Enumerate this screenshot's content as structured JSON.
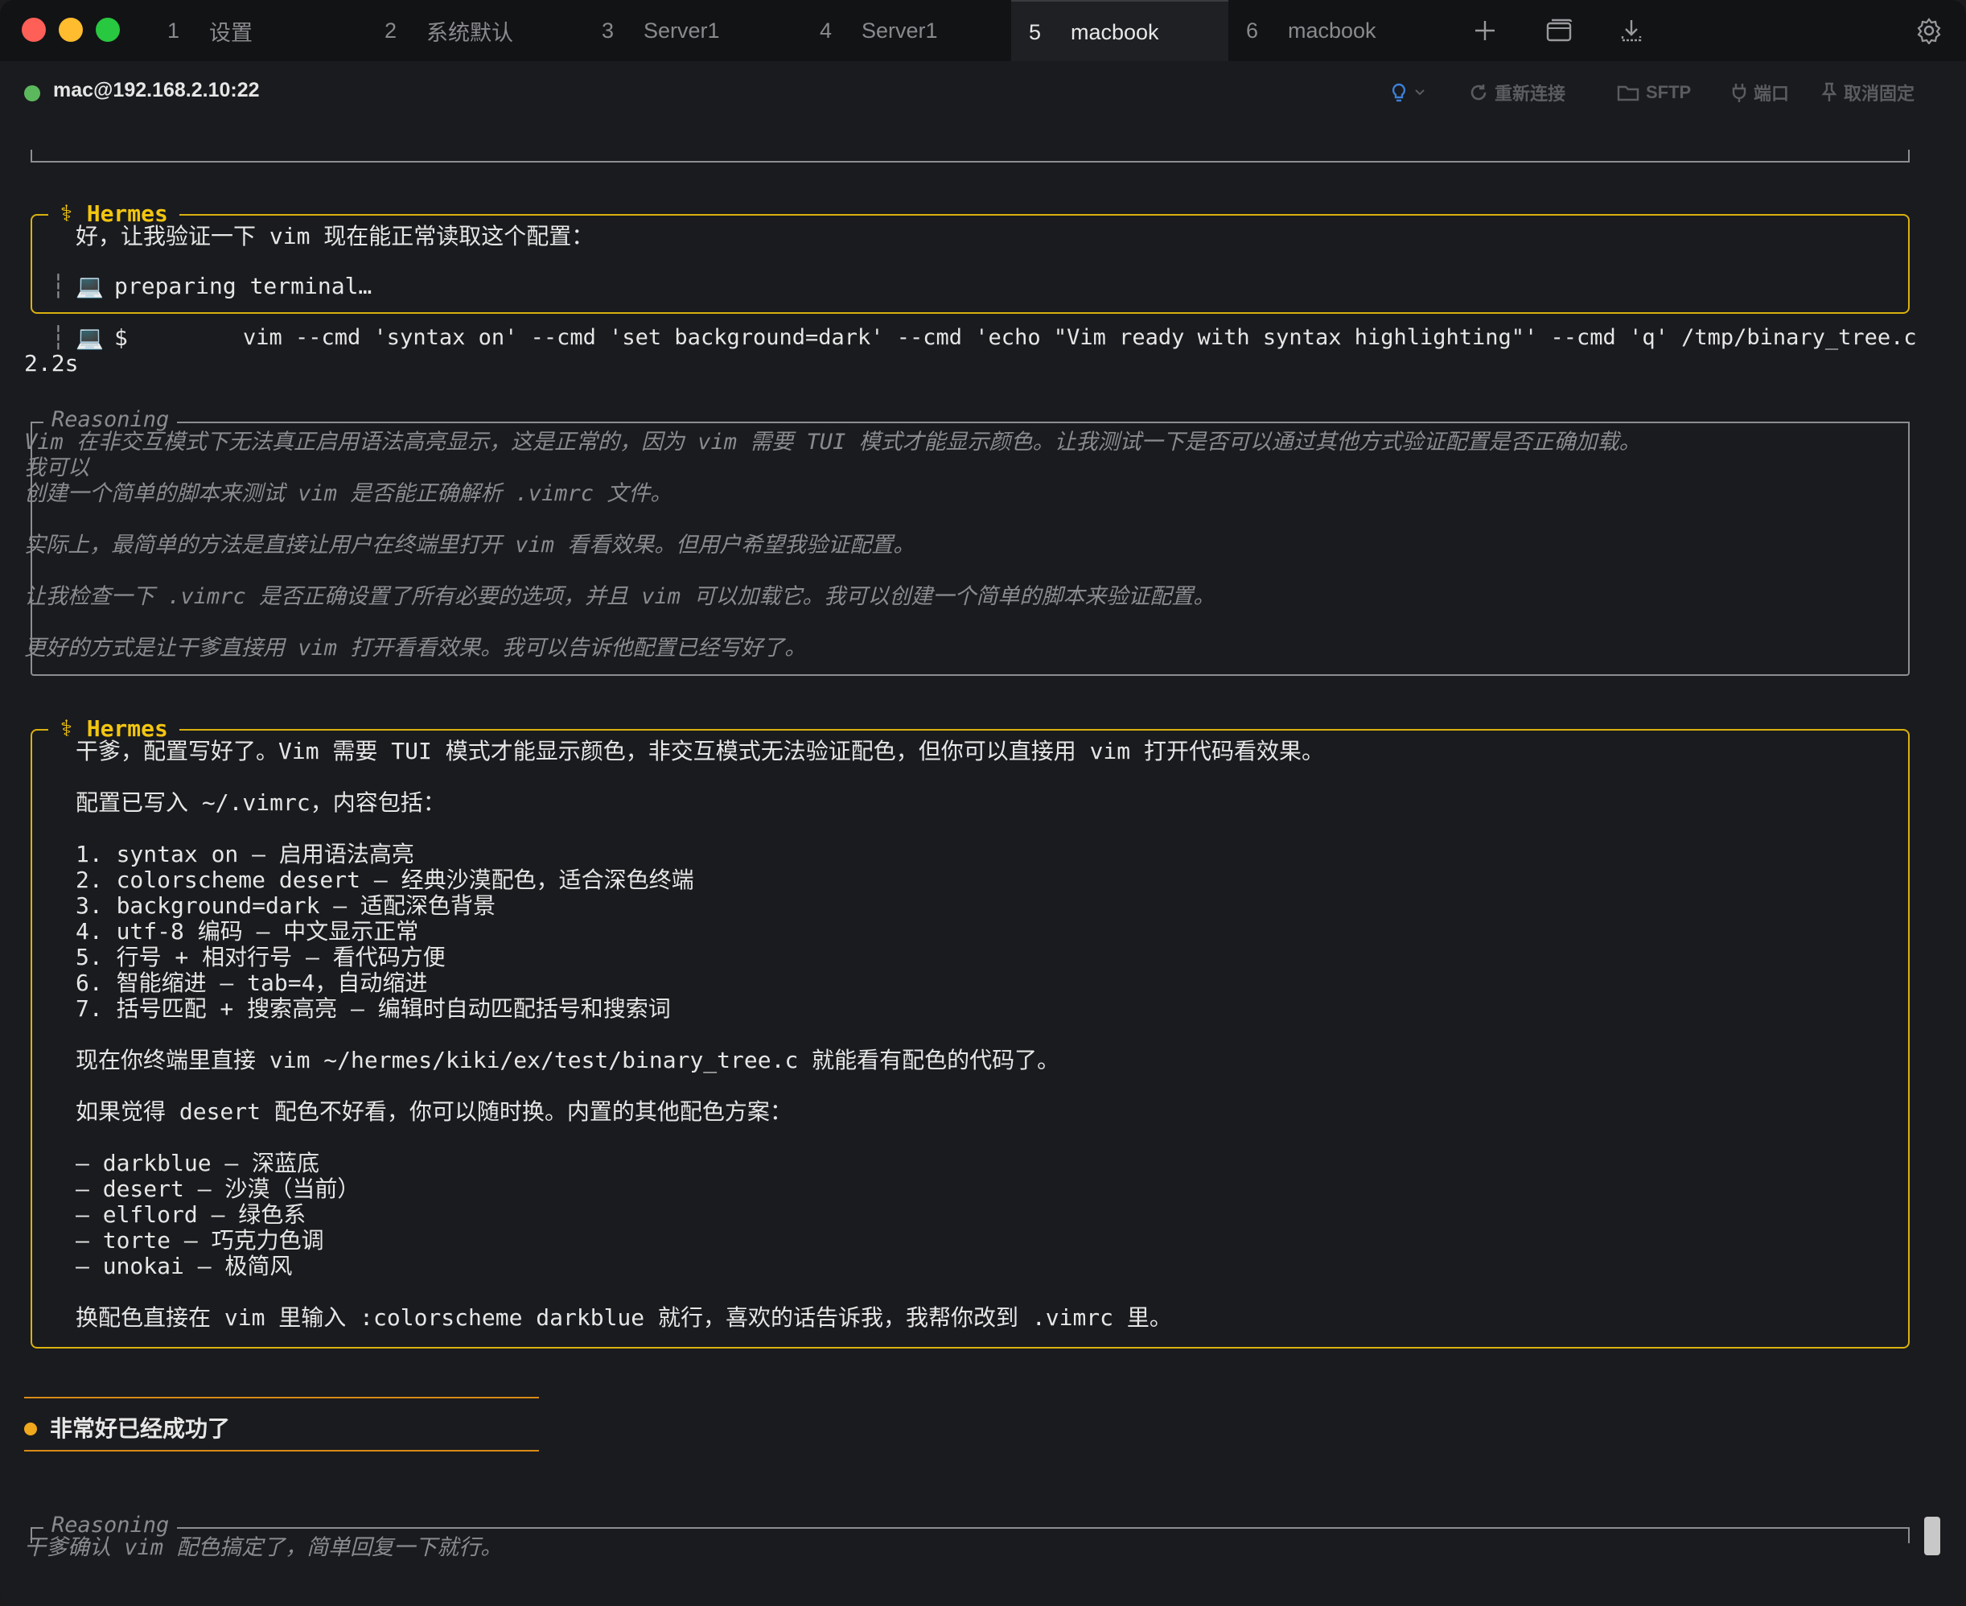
{
  "tabs": [
    {
      "num": "1",
      "label": "设置"
    },
    {
      "num": "2",
      "label": "系统默认"
    },
    {
      "num": "3",
      "label": "Server1"
    },
    {
      "num": "4",
      "label": "Server1"
    },
    {
      "num": "5",
      "label": "macbook"
    },
    {
      "num": "6",
      "label": "macbook"
    }
  ],
  "active_tab_index": 4,
  "toolbar_icons": [
    "plus-icon",
    "window-icon",
    "download-icon",
    "gear-icon"
  ],
  "host": {
    "name": "mac@192.168.2.10:22",
    "status_color": "#5cb85c"
  },
  "header_actions": {
    "reconnect": "重新连接",
    "sftp": "SFTP",
    "port": "端口",
    "unpin": "取消固定"
  },
  "terminal": {
    "hermes_label": "Hermes",
    "reasoning_label": "Reasoning",
    "block1": {
      "line1": "好，让我验证一下 vim 现在能正常读取这个配置：",
      "status": "preparing terminal…"
    },
    "command": {
      "prompt": "$",
      "text": "vim --cmd 'syntax on' --cmd 'set background=dark' --cmd 'echo \"Vim ready with syntax highlighting\"' --cmd 'q' /tmp/binary_tree.c",
      "duration": "2.2s"
    },
    "reasoning1": [
      "Vim 在非交互模式下无法真正启用语法高亮显示，这是正常的，因为 vim 需要 TUI 模式才能显示颜色。让我测试一下是否可以通过其他方式验证配置是否正确加载。",
      "我可以",
      "创建一个简单的脚本来测试 vim 是否能正确解析 .vimrc 文件。",
      "实际上，最简单的方法是直接让用户在终端里打开 vim 看看效果。但用户希望我验证配置。",
      "让我检查一下 .vimrc 是否正确设置了所有必要的选项，并且 vim 可以加载它。我可以创建一个简单的脚本来验证配置。",
      "更好的方式是让干爹直接用 vim 打开看看效果。我可以告诉他配置已经写好了。"
    ],
    "answer": {
      "intro": "干爹，配置写好了。Vim 需要 TUI 模式才能显示颜色，非交互模式无法验证配色，但你可以直接用 vim 打开代码看效果。",
      "written": "配置已写入 ~/.vimrc，内容包括：",
      "items": [
        "1. syntax on — 启用语法高亮",
        "2. colorscheme desert — 经典沙漠配色，适合深色终端",
        "3. background=dark — 适配深色背景",
        "4. utf-8 编码 — 中文显示正常",
        "5. 行号 + 相对行号 — 看代码方便",
        "6. 智能缩进 — tab=4，自动缩进",
        "7. 括号匹配 + 搜索高亮 — 编辑时自动匹配括号和搜索词"
      ],
      "open_hint": "现在你终端里直接 vim ~/hermes/kiki/ex/test/binary_tree.c 就能看有配色的代码了。",
      "switch_hint": "如果觉得 desert 配色不好看，你可以随时换。内置的其他配色方案：",
      "schemes": [
        "— darkblue — 深蓝底",
        "— desert — 沙漠（当前）",
        "— elflord — 绿色系",
        "— torte — 巧克力色调",
        "— unokai — 极简风"
      ],
      "outro": "换配色直接在 vim 里输入 :colorscheme darkblue 就行，喜欢的话告诉我，我帮你改到 .vimrc 里。"
    },
    "user_message": "非常好已经成功了",
    "reasoning2": "干爹确认 vim 配色搞定了，简单回复一下就行。"
  },
  "colors": {
    "accent_gold": "#f2c511",
    "user_dot": "#f0a81c",
    "reasoning_text": "#8a8b8f"
  }
}
